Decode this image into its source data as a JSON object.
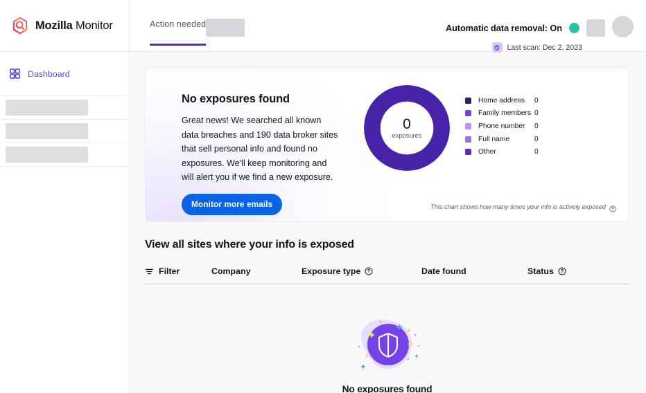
{
  "brand": {
    "bold": "Mozilla",
    "light": "Monitor",
    "logo_icon": "mozilla-monitor-hex-logo"
  },
  "tabs": [
    {
      "label": "Action needed",
      "active": true
    },
    {
      "label": "",
      "placeholder": true
    }
  ],
  "status": {
    "title": "Automatic data removal: On",
    "indicator_color": "#2ac3a2",
    "last_scan": "Last scan: Dec 2, 2023",
    "shield_icon": "shield-check-icon"
  },
  "sidebar": {
    "items": [
      {
        "label": "Dashboard",
        "icon": "grid-squares-icon",
        "active": true
      },
      {
        "label": "",
        "placeholder": true
      },
      {
        "label": "",
        "placeholder": true
      },
      {
        "label": "",
        "placeholder": true
      }
    ]
  },
  "hero": {
    "title": "No exposures found",
    "description": "Great news! We searched all known data breaches and 190 data broker sites that sell personal info and found no exposures. We'll keep monitoring and will alert you if we find a new exposure.",
    "cta_label": "Monitor more emails",
    "cta_color": "#0a62e7",
    "note": "This chart shows how many times your info is actively exposed",
    "note_icon": "question-circle-icon"
  },
  "chart_data": {
    "type": "pie",
    "title": "",
    "center_value": "0",
    "center_label": "exposures",
    "total": 0,
    "ring_color": "#4623a8",
    "legend_position": "right",
    "categories": [
      "Home address",
      "Family members",
      "Phone number",
      "Full name",
      "Other"
    ],
    "values": [
      0,
      0,
      0,
      0,
      0
    ],
    "colors": [
      "#321c64",
      "#7542e5",
      "#c689ff",
      "#9a6ff0",
      "#592acb"
    ],
    "annotation": "This chart shows how many times your info is actively exposed"
  },
  "table": {
    "section_title": "View all sites where your info is exposed",
    "columns": [
      {
        "label": "Filter",
        "icon": "filter-icon"
      },
      {
        "label": "Company"
      },
      {
        "label": "Exposure type",
        "icon": "question-circle-icon"
      },
      {
        "label": "Date found"
      },
      {
        "label": "Status",
        "icon": "question-circle-icon"
      }
    ],
    "rows": []
  },
  "empty_state": {
    "message": "No exposures found",
    "art_icon": "shield-illustration"
  }
}
